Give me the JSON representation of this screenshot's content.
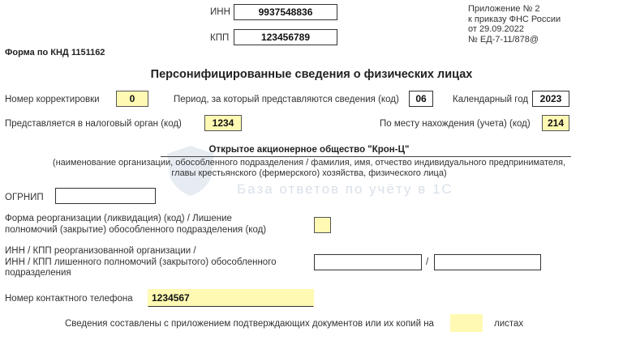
{
  "header": {
    "inn_label": "ИНН",
    "inn_value": "9937548836",
    "kpp_label": "КПП",
    "kpp_value": "123456789",
    "appendix_lines": [
      "Приложение № 2",
      "к приказу ФНС России",
      "от 29.09.2022",
      "№ ЕД-7-11/878@"
    ],
    "form_code": "Форма по КНД 1151162"
  },
  "title": "Персонифицированные сведения о физических лицах",
  "row1": {
    "correction_label": "Номер корректировки",
    "correction_value": "0",
    "period_label": "Период, за который представляются сведения (код)",
    "period_value": "06",
    "year_label": "Календарный год",
    "year_value": "2023"
  },
  "row2": {
    "tax_authority_label": "Представляется в налоговый орган (код)",
    "tax_authority_value": "1234",
    "location_label": "По месту нахождения (учета) (код)",
    "location_value": "214"
  },
  "organization": {
    "name": "Открытое акционерное общество \"Крон-Ц\"",
    "caption_line1": "(наименование организации, обособленного подразделения / фамилия, имя, отчество индивидуального предпринимателя,",
    "caption_line2": "главы крестьянского (фермерского) хозяйства, физического лица)"
  },
  "watermark": "База ответов по учёту в 1С",
  "ogrnip": {
    "label": "ОГРНИП",
    "value": ""
  },
  "reorg": {
    "label_line1": "Форма реорганизации (ликвидация) (код) / Лишение",
    "label_line2": "полномочий (закрытие) обособленного подразделения (код)",
    "value": ""
  },
  "reorg_inn": {
    "label_line1": "ИНН / КПП реорганизованной организации /",
    "label_line2": "ИНН / КПП лишенного полномочий (закрытого) обособленного",
    "label_line3": "подразделения",
    "separator": "/",
    "inn_value": "",
    "kpp_value": ""
  },
  "phone": {
    "label": "Номер контактного телефона",
    "value": "1234567"
  },
  "attachments": {
    "label": "Сведения составлены с приложением подтверждающих документов или их копий на",
    "value": "",
    "suffix": "листах"
  },
  "colors": {
    "yellow_field": "#fff9b3",
    "border": "#333333"
  }
}
